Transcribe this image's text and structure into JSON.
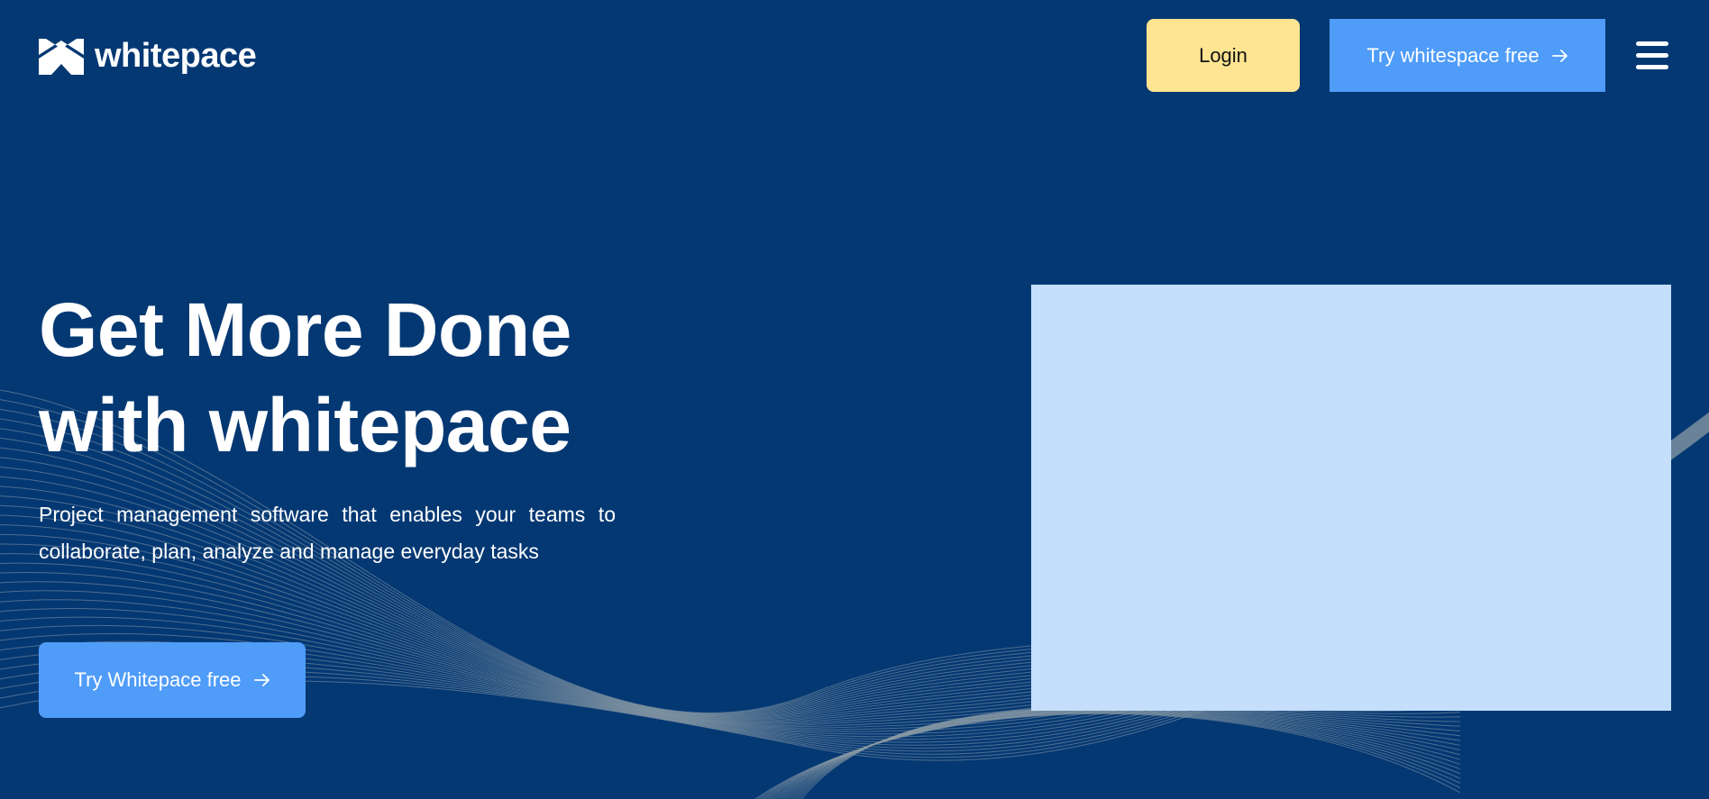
{
  "brand": {
    "name": "whitepace",
    "primary_bg": "#043873",
    "accent_blue": "#4F9CF9",
    "accent_yellow": "#FFE492",
    "image_placeholder": "#C4DEFC"
  },
  "header": {
    "logo_icon": "whitepace-logo-icon",
    "login_label": "Login",
    "try_label": "Try whitespace free",
    "menu_icon": "hamburger-menu-icon"
  },
  "hero": {
    "title_line1": "Get More Done",
    "title_line2": "with whitepace",
    "subtitle": "Project management software that enables your teams to collaborate, plan, analyze and manage everyday tasks",
    "cta_label": "Try Whitepace free",
    "cta_icon": "arrow-right-icon"
  }
}
